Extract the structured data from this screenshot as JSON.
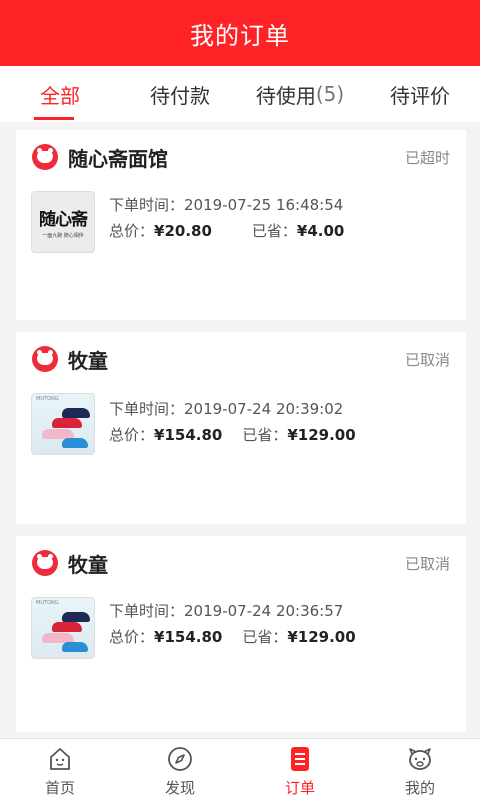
{
  "header": {
    "title": "我的订单"
  },
  "tabs": [
    {
      "label": "全部",
      "count": "",
      "active": true
    },
    {
      "label": "待付款",
      "count": "",
      "active": false
    },
    {
      "label": "待使用",
      "count": "(5)",
      "active": false
    },
    {
      "label": "待评价",
      "count": "",
      "active": false
    }
  ],
  "orders": [
    {
      "shop_name": "随心斋面馆",
      "status": "已超时",
      "time_label": "下单时间：",
      "time": "2019-07-25 16:48:54",
      "total_label": "总价：",
      "total": "¥20.80",
      "saved_label": "已省：",
      "saved": "¥4.00",
      "thumb_text": "随心斋",
      "thumb_sub": "一面九碗 随心相伴"
    },
    {
      "shop_name": "牧童",
      "status": "已取消",
      "time_label": "下单时间：",
      "time": "2019-07-24 20:39:02",
      "total_label": "总价：",
      "total": "¥154.80",
      "saved_label": "已省：",
      "saved": "¥129.00",
      "thumb_brand": "MUTONG"
    },
    {
      "shop_name": "牧童",
      "status": "已取消",
      "time_label": "下单时间：",
      "time": "2019-07-24 20:36:57",
      "total_label": "总价：",
      "total": "¥154.80",
      "saved_label": "已省：",
      "saved": "¥129.00",
      "thumb_brand": "MUTONG"
    }
  ],
  "tabbar": [
    {
      "label": "首页",
      "icon": "home-icon",
      "active": false
    },
    {
      "label": "发现",
      "icon": "compass-icon",
      "active": false
    },
    {
      "label": "订单",
      "icon": "order-list-icon",
      "active": true
    },
    {
      "label": "我的",
      "icon": "profile-icon",
      "active": false
    }
  ],
  "colors": {
    "accent": "#ff2227",
    "logo": "#ee2b3a"
  }
}
